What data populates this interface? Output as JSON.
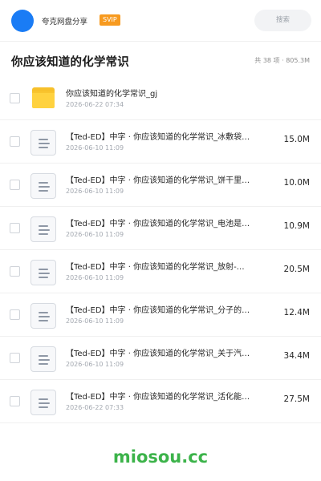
{
  "header": {
    "brand": "夸克网盘分享",
    "badge": "SVIP",
    "search_placeholder": "搜索",
    "colors": {
      "avatar": "#1a7cf5",
      "badge": "#f79a1f"
    }
  },
  "page": {
    "title": "你应该知道的化学常识",
    "summary": "共 38 项 · 805.3M"
  },
  "files": [
    {
      "type": "folder",
      "icon": "folder-icon",
      "name": "你应该知道的化学常识_gj",
      "date": "2026-06-22 07:34",
      "size": ""
    },
    {
      "type": "file",
      "icon": "document-icon",
      "name": "【Ted-ED】中字 · 你应该知道的化学常识_冰敷袋…",
      "date": "2026-06-10 11:09",
      "size": "15.0M"
    },
    {
      "type": "file",
      "icon": "document-icon",
      "name": "【Ted-ED】中字 · 你应该知道的化学常识_饼干里…",
      "date": "2026-06-10 11:09",
      "size": "10.0M"
    },
    {
      "type": "file",
      "icon": "document-icon",
      "name": "【Ted-ED】中字 · 你应该知道的化学常识_电池是…",
      "date": "2026-06-10 11:09",
      "size": "10.9M"
    },
    {
      "type": "file",
      "icon": "document-icon",
      "name": "【Ted-ED】中字 · 你应该知道的化学常识_放射-…",
      "date": "2026-06-10 11:09",
      "size": "20.5M"
    },
    {
      "type": "file",
      "icon": "document-icon",
      "name": "【Ted-ED】中字 · 你应该知道的化学常识_分子的…",
      "date": "2026-06-10 11:09",
      "size": "12.4M"
    },
    {
      "type": "file",
      "icon": "document-icon",
      "name": "【Ted-ED】中字 · 你应该知道的化学常识_关于汽…",
      "date": "2026-06-10 11:09",
      "size": "34.4M"
    },
    {
      "type": "file",
      "icon": "document-icon",
      "name": "【Ted-ED】中字 · 你应该知道的化学常识_活化能…",
      "date": "2026-06-22 07:33",
      "size": "27.5M"
    }
  ],
  "footer": {
    "watermark": "miosou.cc",
    "color": "#3cb34a"
  }
}
